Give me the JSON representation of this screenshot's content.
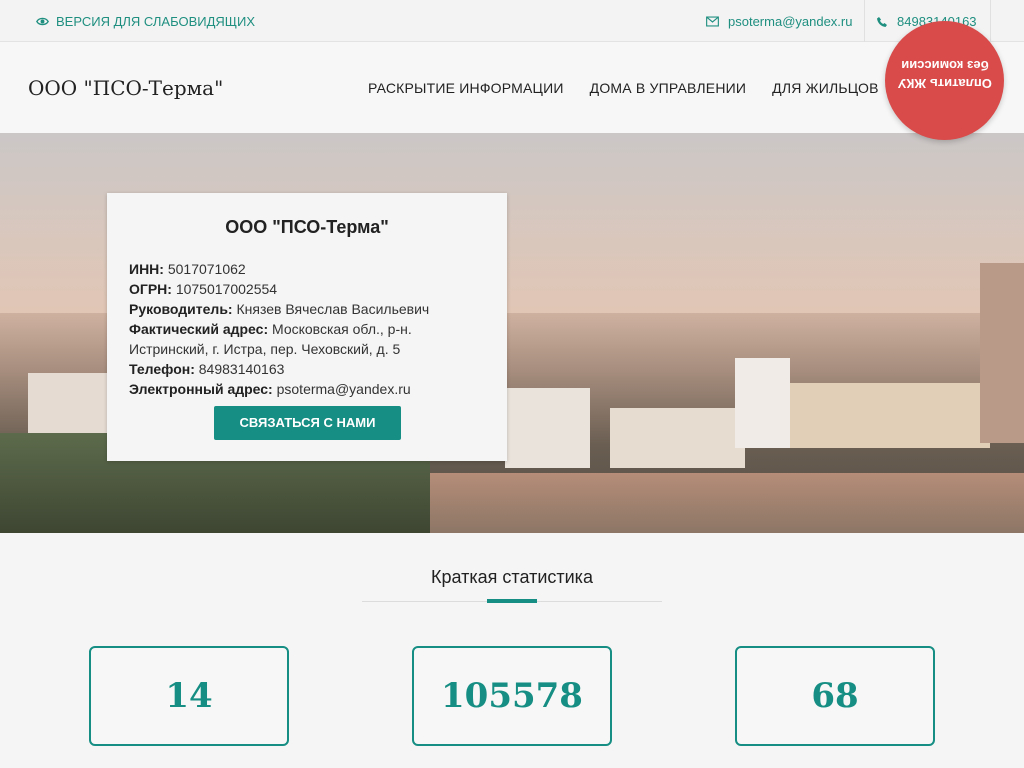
{
  "topbar": {
    "vision_label": "ВЕРСИЯ ДЛЯ СЛАБОВИДЯЩИХ",
    "email": "psoterma@yandex.ru",
    "phone": "84983140163"
  },
  "header": {
    "logo": "ООО \"ПСО-Терма\"",
    "nav": [
      "РАСКРЫТИЕ ИНФОРМАЦИИ",
      "ДОМА В УПРАВЛЕНИИ",
      "ДЛЯ ЖИЛЬЦОВ"
    ],
    "pay_label": "Оплатить ЖКУ\nбез комиссии"
  },
  "card": {
    "title": "ООО \"ПСО-Терма\"",
    "rows": [
      {
        "label": "ИНН:",
        "value": "5017071062"
      },
      {
        "label": "ОГРН:",
        "value": "1075017002554"
      },
      {
        "label": "Руководитель:",
        "value": "Князев Вячеслав Васильевич"
      },
      {
        "label": "Фактический адрес:",
        "value": "Московская обл., р-н. Истринский, г. Истра, пер. Чеховский, д. 5"
      },
      {
        "label": "Телефон:",
        "value": "84983140163"
      },
      {
        "label": "Электронный адрес:",
        "value": "psoterma@yandex.ru"
      }
    ],
    "button": "СВЯЗАТЬСЯ С НАМИ"
  },
  "stats": {
    "title": "Краткая статистика",
    "items": [
      {
        "value": "14"
      },
      {
        "value": "105578"
      },
      {
        "value": "68"
      }
    ]
  }
}
